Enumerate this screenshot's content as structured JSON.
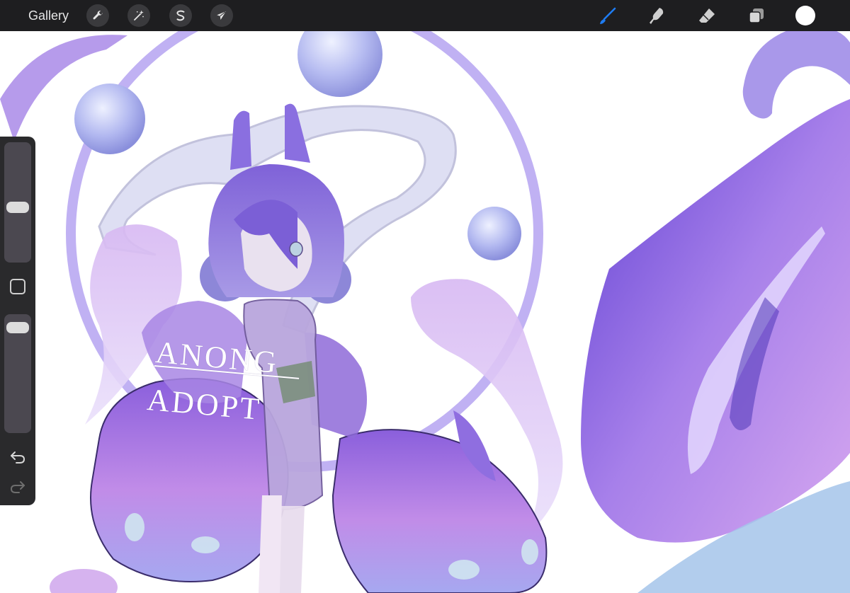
{
  "toolbar": {
    "gallery_label": "Gallery",
    "left_tools": [
      {
        "name": "actions",
        "icon": "wrench-icon"
      },
      {
        "name": "adjustments",
        "icon": "magic-wand-icon"
      },
      {
        "name": "selection",
        "icon": "selection-s-icon"
      },
      {
        "name": "transform",
        "icon": "arrow-cursor-icon"
      }
    ],
    "right_tools": [
      {
        "name": "brush",
        "icon": "brush-icon",
        "active": true
      },
      {
        "name": "smudge",
        "icon": "smudge-icon"
      },
      {
        "name": "eraser",
        "icon": "eraser-icon"
      },
      {
        "name": "layers",
        "icon": "layers-icon"
      },
      {
        "name": "color",
        "icon": "color-swatch",
        "value": "#ffffff"
      }
    ],
    "active_color": "#1e7cf2"
  },
  "sidebar": {
    "brush_size_level": 0.45,
    "opacity_level": 0.95,
    "modify_icon": "square-icon",
    "undo_icon": "undo-icon",
    "redo_icon": "redo-icon"
  },
  "canvas": {
    "watermark_line1": "ANONG",
    "watermark_line2": "ADOPT",
    "palette": {
      "violet": "#7b5fd6",
      "lavender": "#b9a4ee",
      "pink": "#d9a8e8",
      "pale": "#c9c8e9",
      "blue": "#8fb1ea"
    }
  }
}
